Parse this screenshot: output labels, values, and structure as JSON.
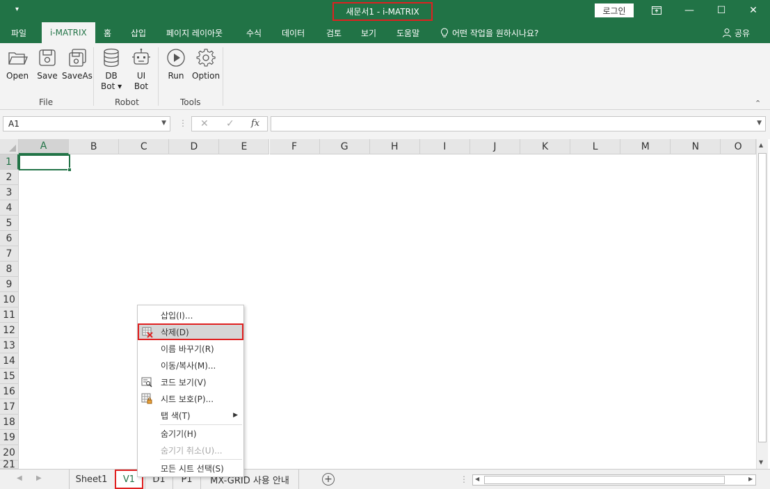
{
  "titlebar": {
    "quick_access": "▾",
    "title": "새문서1  -  i-MATRIX",
    "login_label": "로그인",
    "controls": {
      "ribbon_display": "ribbon-display-icon",
      "minimize": "—",
      "maximize": "☐",
      "close": "✕"
    }
  },
  "tabs": [
    {
      "label": "파일"
    },
    {
      "label": "i-MATRIX",
      "active": true
    },
    {
      "label": "홈"
    },
    {
      "label": "삽입"
    },
    {
      "label": "페이지 레이아웃"
    },
    {
      "label": "수식"
    },
    {
      "label": "데이터"
    },
    {
      "label": "검토"
    },
    {
      "label": "보기"
    },
    {
      "label": "도움말"
    },
    {
      "label": "어떤 작업을 원하시나요?"
    }
  ],
  "share_label": "공유",
  "ribbon": {
    "groups": [
      {
        "label": "File",
        "buttons": [
          {
            "label": "Open",
            "icon": "folder-open-icon"
          },
          {
            "label": "Save",
            "icon": "save-icon"
          },
          {
            "label": "SaveAs",
            "icon": "save-as-icon"
          }
        ]
      },
      {
        "label": "Robot",
        "buttons": [
          {
            "label": "DB",
            "label2": "Bot ▾",
            "icon": "database-icon"
          },
          {
            "label": "UI",
            "label2": "Bot",
            "icon": "robot-icon"
          }
        ]
      },
      {
        "label": "Tools",
        "buttons": [
          {
            "label": "Run",
            "icon": "play-icon"
          },
          {
            "label": "Option",
            "icon": "gear-icon"
          }
        ]
      }
    ]
  },
  "formula_bar": {
    "name_box": "A1",
    "cancel": "✕",
    "enter": "✓",
    "fx": "fx",
    "value": ""
  },
  "grid": {
    "columns": [
      "A",
      "B",
      "C",
      "D",
      "E",
      "F",
      "G",
      "H",
      "I",
      "J",
      "K",
      "L",
      "M",
      "N",
      "O"
    ],
    "rows": [
      "1",
      "2",
      "3",
      "4",
      "5",
      "6",
      "7",
      "8",
      "9",
      "10",
      "11",
      "12",
      "13",
      "14",
      "15",
      "16",
      "17",
      "18",
      "19",
      "20",
      "21"
    ],
    "selected_cell": "A1"
  },
  "sheets": [
    {
      "label": "Sheet1"
    },
    {
      "label": "V1",
      "active": true
    },
    {
      "label": "D1"
    },
    {
      "label": "P1"
    },
    {
      "label": "MX-GRID 사용 안내"
    }
  ],
  "context_menu": {
    "items": [
      {
        "label": "삽입(I)...",
        "disabled": false
      },
      {
        "label": "삭제(D)",
        "icon": "delete-sheet-icon",
        "highlighted": true
      },
      {
        "label": "이름 바꾸기(R)"
      },
      {
        "label": "이동/복사(M)..."
      },
      {
        "label": "코드 보기(V)",
        "icon": "view-code-icon"
      },
      {
        "label": "시트 보호(P)...",
        "icon": "protect-sheet-icon"
      },
      {
        "label": "탭 색(T)",
        "submenu": true
      },
      {
        "label": "숨기기(H)"
      },
      {
        "label": "숨기기 취소(U)...",
        "disabled": true
      },
      {
        "label": "모든 시트 선택(S)"
      }
    ]
  },
  "colors": {
    "accent": "#217346",
    "highlight_border": "#e02020"
  }
}
